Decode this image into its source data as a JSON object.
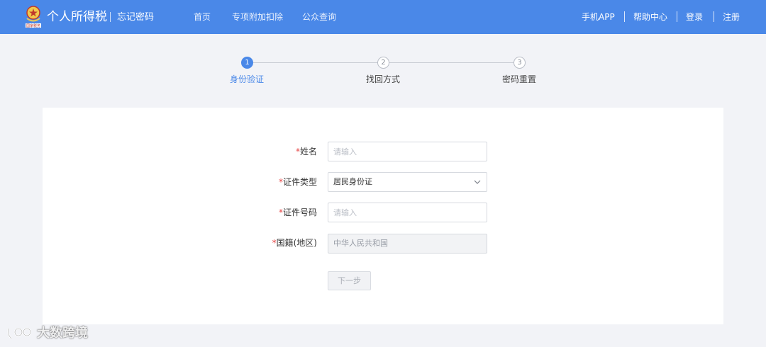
{
  "header": {
    "brand_title": "个人所得税",
    "brand_subtitle": "忘记密码",
    "nav": [
      "首页",
      "专项附加扣除",
      "公众查询"
    ],
    "right_links": [
      "手机APP",
      "帮助中心",
      "登录",
      "注册"
    ],
    "emblem_caption": "国家税务",
    "accent_color": "#4a88e8"
  },
  "steps": [
    {
      "number": "1",
      "label": "身份验证",
      "active": true
    },
    {
      "number": "2",
      "label": "找回方式",
      "active": false
    },
    {
      "number": "3",
      "label": "密码重置",
      "active": false
    }
  ],
  "form": {
    "required_mark": "*",
    "name": {
      "label": "姓名",
      "placeholder": "请输入",
      "value": ""
    },
    "id_type": {
      "label": "证件类型",
      "value": "居民身份证"
    },
    "id_number": {
      "label": "证件号码",
      "placeholder": "请输入",
      "value": ""
    },
    "nationality": {
      "label": "国籍(地区)",
      "value": "中华人民共和国"
    },
    "next_label": "下一步"
  },
  "watermark": {
    "text": "大数跨境"
  }
}
